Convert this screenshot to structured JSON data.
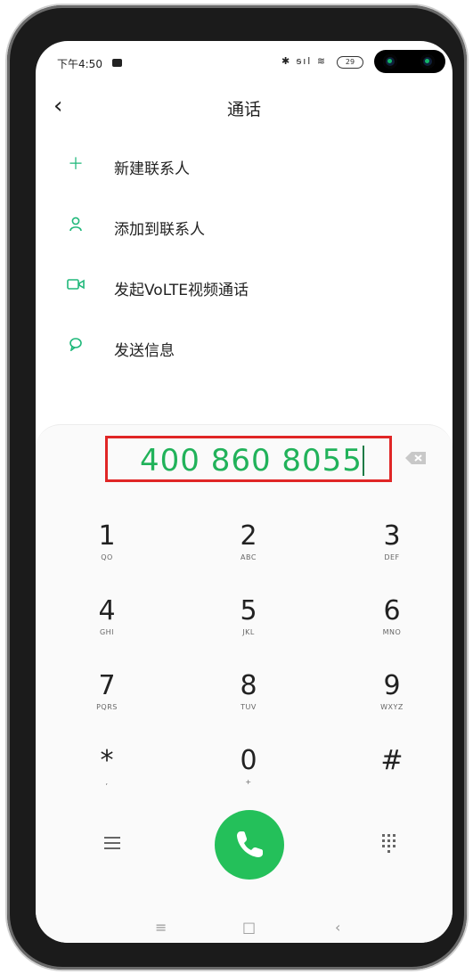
{
  "status_bar": {
    "time": "下午4:50",
    "signal_icons": "✱ ᵴıl ≋",
    "battery": "29"
  },
  "header": {
    "back_icon": "chevron-left-icon",
    "title": "通话"
  },
  "menu": [
    {
      "icon": "plus-icon",
      "label": "新建联系人"
    },
    {
      "icon": "person-icon",
      "label": "添加到联系人"
    },
    {
      "icon": "video-icon",
      "label": "发起VoLTE视频通话"
    },
    {
      "icon": "chat-bubble-icon",
      "label": "发送信息"
    }
  ],
  "dialer": {
    "number": "400 860 8055",
    "keys": [
      {
        "digit": "1",
        "letters": "QO"
      },
      {
        "digit": "2",
        "letters": "ABC"
      },
      {
        "digit": "3",
        "letters": "DEF"
      },
      {
        "digit": "4",
        "letters": "GHI"
      },
      {
        "digit": "5",
        "letters": "JKL"
      },
      {
        "digit": "6",
        "letters": "MNO"
      },
      {
        "digit": "7",
        "letters": "PQRS"
      },
      {
        "digit": "8",
        "letters": "TUV"
      },
      {
        "digit": "9",
        "letters": "WXYZ"
      },
      {
        "digit": "*",
        "letters": ","
      },
      {
        "digit": "0",
        "letters": "+"
      },
      {
        "digit": "#",
        "letters": ""
      }
    ]
  },
  "colors": {
    "accent": "#24c05a",
    "highlight_box": "#e02626",
    "number_text": "#21b25a"
  },
  "navbar": {
    "menu": "≡",
    "home": "□",
    "back": "‹"
  }
}
